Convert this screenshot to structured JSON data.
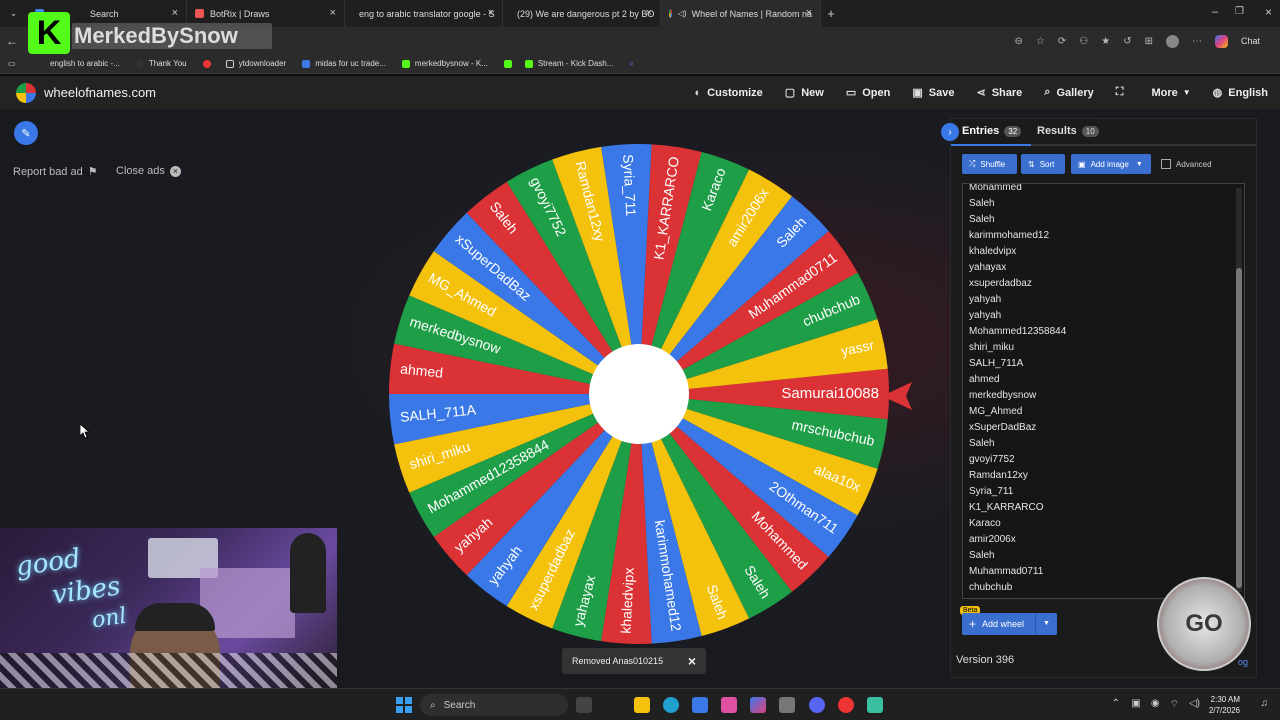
{
  "browser": {
    "tabs": [
      {
        "label": "Search",
        "color": "#4285f4"
      },
      {
        "label": "BotRix | Draws",
        "color": "#e55"
      },
      {
        "label": "eng to arabic translator google - S",
        "color": "#4285f4"
      },
      {
        "label": "(29) We are dangerous pt 2 by BO",
        "color": "#e33"
      },
      {
        "label": "Wheel of Names | Random na",
        "color": "#ddd"
      }
    ],
    "overlay_text": "MerkedBySnow",
    "bookmarks": [
      "english to arabic -...",
      "Thank You",
      "",
      "ytdownloader",
      "midas for uc trade...",
      "merkedbysnow - K...",
      "",
      "Stream - Kick Dash..."
    ],
    "chat_label": "Chat"
  },
  "site": {
    "logo": "wheelofnames.com",
    "nav": [
      {
        "label": "Customize",
        "icon": "palette-icon"
      },
      {
        "label": "New",
        "icon": "new-file-icon"
      },
      {
        "label": "Open",
        "icon": "folder-icon"
      },
      {
        "label": "Save",
        "icon": "save-icon"
      },
      {
        "label": "Share",
        "icon": "share-icon"
      },
      {
        "label": "Gallery",
        "icon": "search-icon"
      },
      {
        "label": "",
        "icon": "fullscreen-icon"
      },
      {
        "label": "More",
        "icon": "chevron-down-icon"
      },
      {
        "label": "English",
        "icon": "globe-icon"
      }
    ],
    "report_ad": "Report bad ad",
    "close_ads": "Close ads"
  },
  "wheel": {
    "colors": [
      "#db3236",
      "#3a78e8",
      "#f4c20d",
      "#1f9e48"
    ],
    "segments": [
      "Samurai10088",
      "mrschubchub",
      "alaa10x",
      "2Othman711",
      "Mohammed",
      "Saleh",
      "Saleh",
      "karimmohamed12",
      "khaledvipx",
      "yahayax",
      "xsuperdadbaz",
      "yahyah",
      "yahyah",
      "Mohammed12358844",
      "shiri_miku",
      "SALH_711A",
      "ahmed",
      "merkedbysnow",
      "MG_Ahmed",
      "xSuperDadBaz",
      "Saleh",
      "gvoyi7752",
      "Ramdan12xy",
      "Syria_711",
      "K1_KARRARCO",
      "Karaco",
      "amir2006x",
      "Saleh",
      "Muhammad0711",
      "chubchub",
      "yassr"
    ]
  },
  "panel": {
    "tabs": [
      {
        "label": "Entries",
        "count": "32"
      },
      {
        "label": "Results",
        "count": "10"
      }
    ],
    "buttons": {
      "shuffle": "Shuffle",
      "sort": "Sort",
      "add_image": "Add image",
      "advanced": "Advanced"
    },
    "entries": [
      "Mohammed",
      "Saleh",
      "Saleh",
      "karimmohamed12",
      "khaledvipx",
      "yahayax",
      "xsuperdadbaz",
      "yahyah",
      "yahyah",
      "Mohammed12358844",
      "shiri_miku",
      "SALH_711A",
      "ahmed",
      "merkedbysnow",
      "MG_Ahmed",
      "xSuperDadBaz",
      "Saleh",
      "gvoyi7752",
      "Ramdan12xy",
      "Syria_711",
      "K1_KARRARCO",
      "Karaco",
      "amir2006x",
      "Saleh",
      "Muhammad0711",
      "chubchub"
    ],
    "beta": "Beta",
    "add_wheel": "Add wheel",
    "version": "Version 396",
    "changelog": "og"
  },
  "toast": {
    "text": "Removed Anas010215"
  },
  "webcam": {
    "neon_text": [
      "good",
      "vibes",
      "onl"
    ]
  },
  "taskbar": {
    "search": "Search",
    "time": "2:30 AM",
    "date": "2/7/2026"
  }
}
